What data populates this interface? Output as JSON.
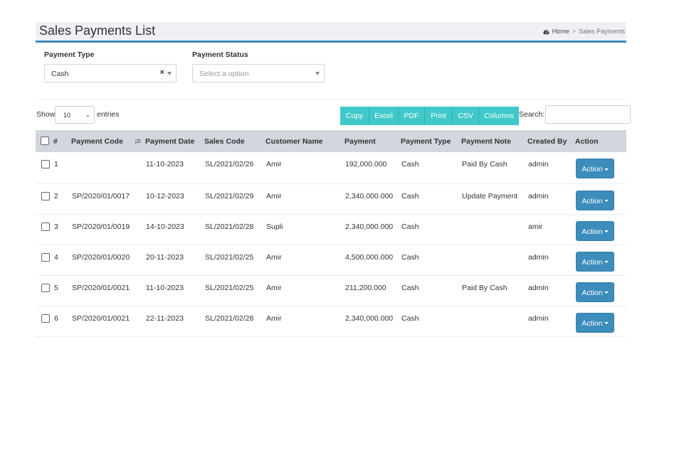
{
  "header": {
    "title": "Sales Payments List",
    "breadcrumb_home": "Home",
    "breadcrumb_sep": ">",
    "breadcrumb_current": "Sales Payments"
  },
  "filters": {
    "payment_type_label": "Payment Type",
    "payment_type_value": "Cash",
    "payment_type_clear": "×",
    "payment_status_label": "Payment Status",
    "payment_status_placeholder": "Select a option"
  },
  "length": {
    "show": "Show",
    "value": "10",
    "entries": "entries"
  },
  "buttons": [
    "Copy",
    "Excel",
    "PDF",
    "Print",
    "CSV",
    "Columns"
  ],
  "search": {
    "label": "Search:"
  },
  "table": {
    "columns": [
      "#",
      "Payment Code",
      "Payment Date",
      "Sales Code",
      "Customer Name",
      "Payment",
      "Payment Type",
      "Payment Note",
      "Created By",
      "Action"
    ],
    "rows": [
      {
        "no": "1",
        "code": "",
        "date": "11-10-2023",
        "sales": "SL/2021/02/26",
        "customer": "Amir",
        "payment": "192,000.000",
        "type": "Cash",
        "note": "Paid By Cash",
        "by": "admin",
        "action": "Action"
      },
      {
        "no": "2",
        "code": "SP/2020/01/0017",
        "date": "10-12-2023",
        "sales": "SL/2021/02/29",
        "customer": "Amir",
        "payment": "2,340,000.000",
        "type": "Cash",
        "note": "Update Payment",
        "by": "admin",
        "action": "Action"
      },
      {
        "no": "3",
        "code": "SP/2020/01/0019",
        "date": "14-10-2023",
        "sales": "SL/2021/02/28",
        "customer": "Supli",
        "payment": "2,340,000.000",
        "type": "Cash",
        "note": "",
        "by": "amir",
        "action": "Action"
      },
      {
        "no": "4",
        "code": "SP/2020/01/0020",
        "date": "20-11-2023",
        "sales": "SL/2021/02/25",
        "customer": "Amir",
        "payment": "4,500,000.000",
        "type": "Cash",
        "note": "",
        "by": "admin",
        "action": "Action"
      },
      {
        "no": "5",
        "code": "SP/2020/01/0021",
        "date": "11-10-2023",
        "sales": "SL/2021/02/25",
        "customer": "Amir",
        "payment": "211,200.000",
        "type": "Cash",
        "note": "Paid By Cash",
        "by": "admin",
        "action": "Action"
      },
      {
        "no": "6",
        "code": "SP/2020/01/0021",
        "date": "22-11-2023",
        "sales": "SL/2021/02/28",
        "customer": "Amir",
        "payment": "2,340,000.000",
        "type": "Cash",
        "note": "",
        "by": "admin",
        "action": "Action"
      }
    ]
  },
  "colors": {
    "accent": "#3c8dbc",
    "export_button": "#41c9c9",
    "header_bg": "#d2d6de"
  }
}
